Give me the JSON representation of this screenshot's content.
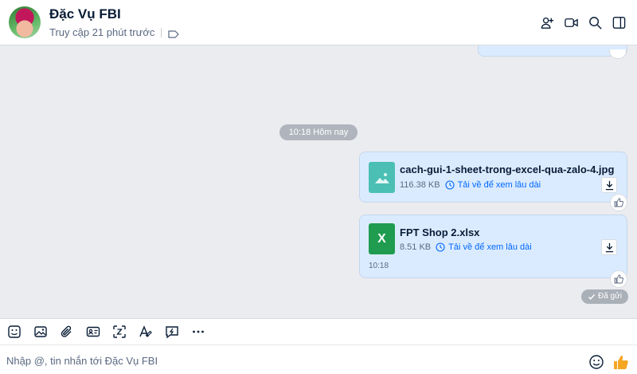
{
  "header": {
    "contact_name": "Đặc Vụ FBI",
    "status": "Truy cập 21 phút trước",
    "icons": [
      "tag-icon",
      "add-to-group-icon",
      "video-call-icon",
      "search-icon",
      "toggle-panel-icon"
    ]
  },
  "chat": {
    "date_divider": "10:18 Hôm nay",
    "messages": [
      {
        "file_name": "cach-gui-1-sheet-trong-excel-qua-zalo-4.jpg",
        "size": "116.38 KB",
        "storage_note": "Tải về để xem lâu dài",
        "icon": "image-file-icon"
      },
      {
        "file_name": "FPT Shop 2.xlsx",
        "size": "8.51 KB",
        "storage_note": "Tải về để xem lâu dài",
        "icon": "excel-file-icon",
        "icon_letter": "X",
        "time": "10:18"
      }
    ],
    "sent_status": "Đã gửi"
  },
  "toolbar": {
    "tools": [
      "sticker-icon",
      "image-icon",
      "attach-icon",
      "contact-card-icon",
      "screenshot-icon",
      "text-format-icon",
      "quick-message-icon",
      "more-icon"
    ]
  },
  "composer": {
    "placeholder": "Nhập @, tin nhắn tới Đặc Vụ FBI",
    "value": ""
  },
  "colors": {
    "accent": "#0068ff",
    "bubble": "#dbebff",
    "chat_bg": "#ebecf0",
    "excel": "#1f9c4f",
    "image_file": "#4bbfb4",
    "like": "#f5a623"
  }
}
